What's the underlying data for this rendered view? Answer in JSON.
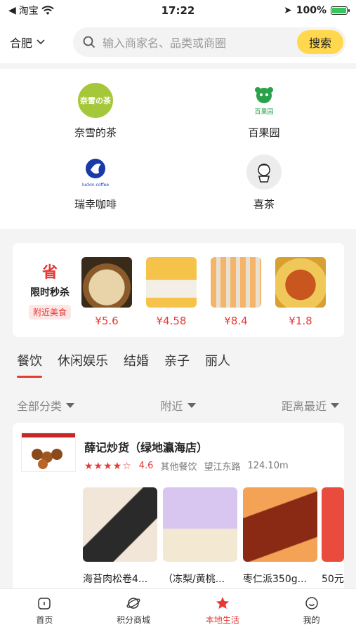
{
  "status_bar": {
    "back_app": "淘宝",
    "time": "17:22",
    "battery": "100%",
    "battery_level": 1.0
  },
  "header": {
    "city": "合肥",
    "search_placeholder": "输入商家名、品类或商圈",
    "search_button": "搜索"
  },
  "brands": [
    {
      "name": "奈雪的茶",
      "logo_text": "奈雪の茶"
    },
    {
      "name": "百果园",
      "logo_text": "百果园"
    },
    {
      "name": "瑞幸咖啡",
      "logo_text": "luckin coffee"
    },
    {
      "name": "喜茶",
      "logo_text": ""
    }
  ],
  "flash_sale": {
    "badge": "省",
    "title": "限时秒杀",
    "tag": "附近美食",
    "deals": [
      {
        "price": "¥5.6",
        "icon": "noodle-bowl"
      },
      {
        "price": "¥4.58",
        "icon": "cake"
      },
      {
        "price": "¥8.4",
        "icon": "skewers"
      },
      {
        "price": "¥1.8",
        "icon": "spicy-noodles"
      }
    ]
  },
  "tabs": [
    "餐饮",
    "休闲娱乐",
    "结婚",
    "亲子",
    "丽人"
  ],
  "filters": {
    "category": "全部分类",
    "nearby": "附近",
    "sort": "距离最近"
  },
  "shop": {
    "name": "薛记炒货（绿地瀛海店）",
    "rating": "4.6",
    "stars": "★★★★☆",
    "category": "其他餐饮",
    "location": "望江东路",
    "distance": "124.10m",
    "products": [
      {
        "name": "海苔肉松卷4..."
      },
      {
        "name": "（冻梨/黄桃..."
      },
      {
        "name": "枣仁派350g..."
      },
      {
        "name": "50元"
      }
    ]
  },
  "bottom_nav": [
    {
      "label": "首页"
    },
    {
      "label": "积分商城"
    },
    {
      "label": "本地生活"
    },
    {
      "label": "我的"
    }
  ]
}
